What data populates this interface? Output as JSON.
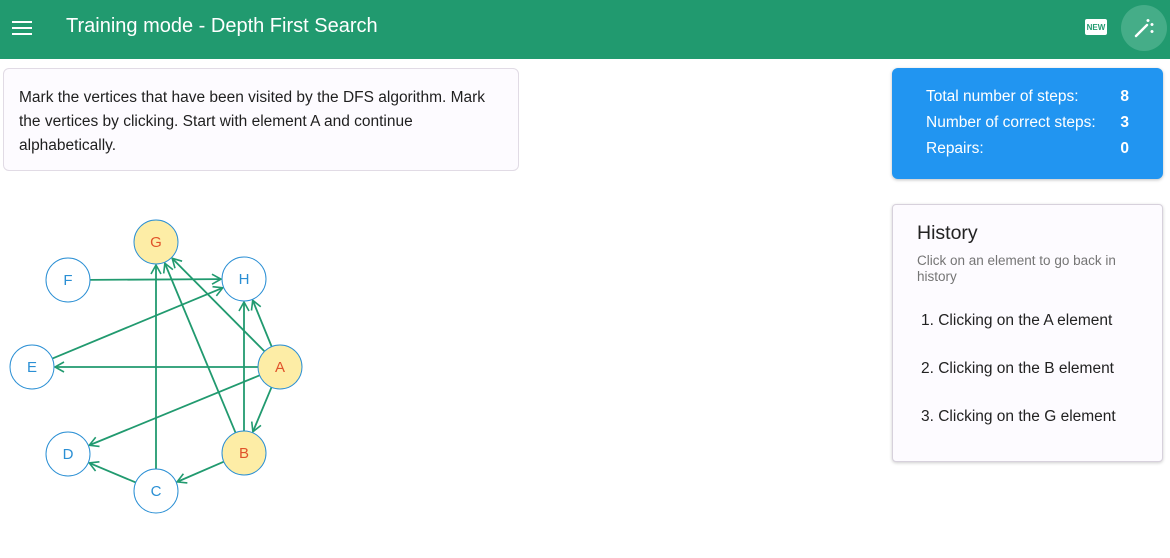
{
  "appbar": {
    "title": "Training mode - Depth First Search",
    "new_badge": "NEW",
    "menu_icon": "hamburger-menu-icon",
    "magic_icon": "magic-wand-icon"
  },
  "task": {
    "text": "Mark the vertices that have been visited by the DFS algorithm. Mark the vertices by clicking. Start with element A and continue alphabetically."
  },
  "stats": {
    "total_label": "Total number of steps:",
    "total_value": "8",
    "correct_label": "Number of correct steps:",
    "correct_value": "3",
    "repairs_label": "Repairs:",
    "repairs_value": "0"
  },
  "history": {
    "title": "History",
    "subtitle": "Click on an element to go back in history",
    "items": [
      "1. Clicking on the A element",
      "2. Clicking on the B element",
      "3. Clicking on the G element"
    ]
  },
  "graph": {
    "colors": {
      "edge": "#219a6f",
      "visited_fill": "#fdeda6",
      "visited_text": "#e0532a",
      "unvisited_fill": "#ffffff",
      "unvisited_text": "#2a8fd4",
      "border": "#2a8fd4"
    },
    "vertices": [
      {
        "id": "A",
        "visited": true
      },
      {
        "id": "B",
        "visited": true
      },
      {
        "id": "C",
        "visited": false
      },
      {
        "id": "D",
        "visited": false
      },
      {
        "id": "E",
        "visited": false
      },
      {
        "id": "F",
        "visited": false
      },
      {
        "id": "G",
        "visited": true
      },
      {
        "id": "H",
        "visited": false
      }
    ],
    "edges": [
      [
        "A",
        "H"
      ],
      [
        "A",
        "G"
      ],
      [
        "A",
        "E"
      ],
      [
        "A",
        "D"
      ],
      [
        "A",
        "B"
      ],
      [
        "B",
        "H"
      ],
      [
        "B",
        "G"
      ],
      [
        "B",
        "C"
      ],
      [
        "C",
        "G"
      ],
      [
        "C",
        "D"
      ],
      [
        "E",
        "H"
      ],
      [
        "F",
        "H"
      ]
    ]
  }
}
